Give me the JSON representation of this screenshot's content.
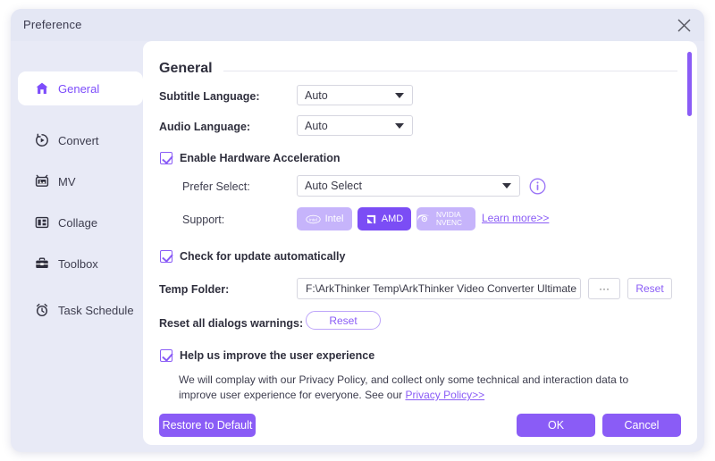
{
  "window": {
    "title": "Preference",
    "close_icon": "close-icon"
  },
  "sidebar": {
    "items": [
      {
        "label": "General",
        "icon": "home-icon",
        "active": true
      },
      {
        "label": "Convert",
        "icon": "convert-icon",
        "active": false
      },
      {
        "label": "MV",
        "icon": "mv-icon",
        "active": false
      },
      {
        "label": "Collage",
        "icon": "collage-icon",
        "active": false
      },
      {
        "label": "Toolbox",
        "icon": "toolbox-icon",
        "active": false
      },
      {
        "label": "Task Schedule",
        "icon": "alarm-clock-icon",
        "active": false
      }
    ]
  },
  "content": {
    "section_title": "General",
    "subtitle_language": {
      "label": "Subtitle Language:",
      "value": "Auto"
    },
    "audio_language": {
      "label": "Audio Language:",
      "value": "Auto"
    },
    "hardware_acceleration": {
      "checkbox_label": "Enable Hardware Acceleration",
      "checked": true,
      "prefer_select_label": "Prefer Select:",
      "prefer_select_value": "Auto Select",
      "info_icon": "info-icon",
      "support_label": "Support:",
      "badges": [
        {
          "name": "Intel",
          "icon": "intel-logo-icon",
          "active": false
        },
        {
          "name": "AMD",
          "icon": "amd-logo-icon",
          "active": true
        },
        {
          "name": "NVIDIA NVENC",
          "icon": "nvidia-logo-icon",
          "active": false
        }
      ],
      "learn_more": "Learn more>>"
    },
    "check_update": {
      "checkbox_label": "Check for update automatically",
      "checked": true
    },
    "temp_folder": {
      "label": "Temp Folder:",
      "value": "F:\\ArkThinker Temp\\ArkThinker Video Converter Ultimate",
      "browse_label": "···",
      "reset_label": "Reset"
    },
    "reset_dialogs": {
      "label": "Reset all dialogs warnings:",
      "button_label": "Reset"
    },
    "improve_experience": {
      "checkbox_label": "Help us improve the user experience",
      "checked": true,
      "description_part1": "We will complay with our Privacy Policy, and collect only some technical and interaction data to improve user experience for everyone. See our ",
      "privacy_link": "Privacy Policy>>"
    },
    "footer": {
      "restore_label": "Restore to Default",
      "ok_label": "OK",
      "cancel_label": "Cancel"
    }
  },
  "theme": {
    "accent": "#8a5cf6",
    "accent_dark": "#7b4df5",
    "accent_light": "#c6b4fb",
    "window_bg": "#e8eaf6",
    "titlebar_bg": "#e4e7f4",
    "panel_bg": "#ffffff",
    "text": "#2f2f3d"
  },
  "scrollbar": {
    "orientation": "vertical",
    "thumb_position_pct": 0
  }
}
